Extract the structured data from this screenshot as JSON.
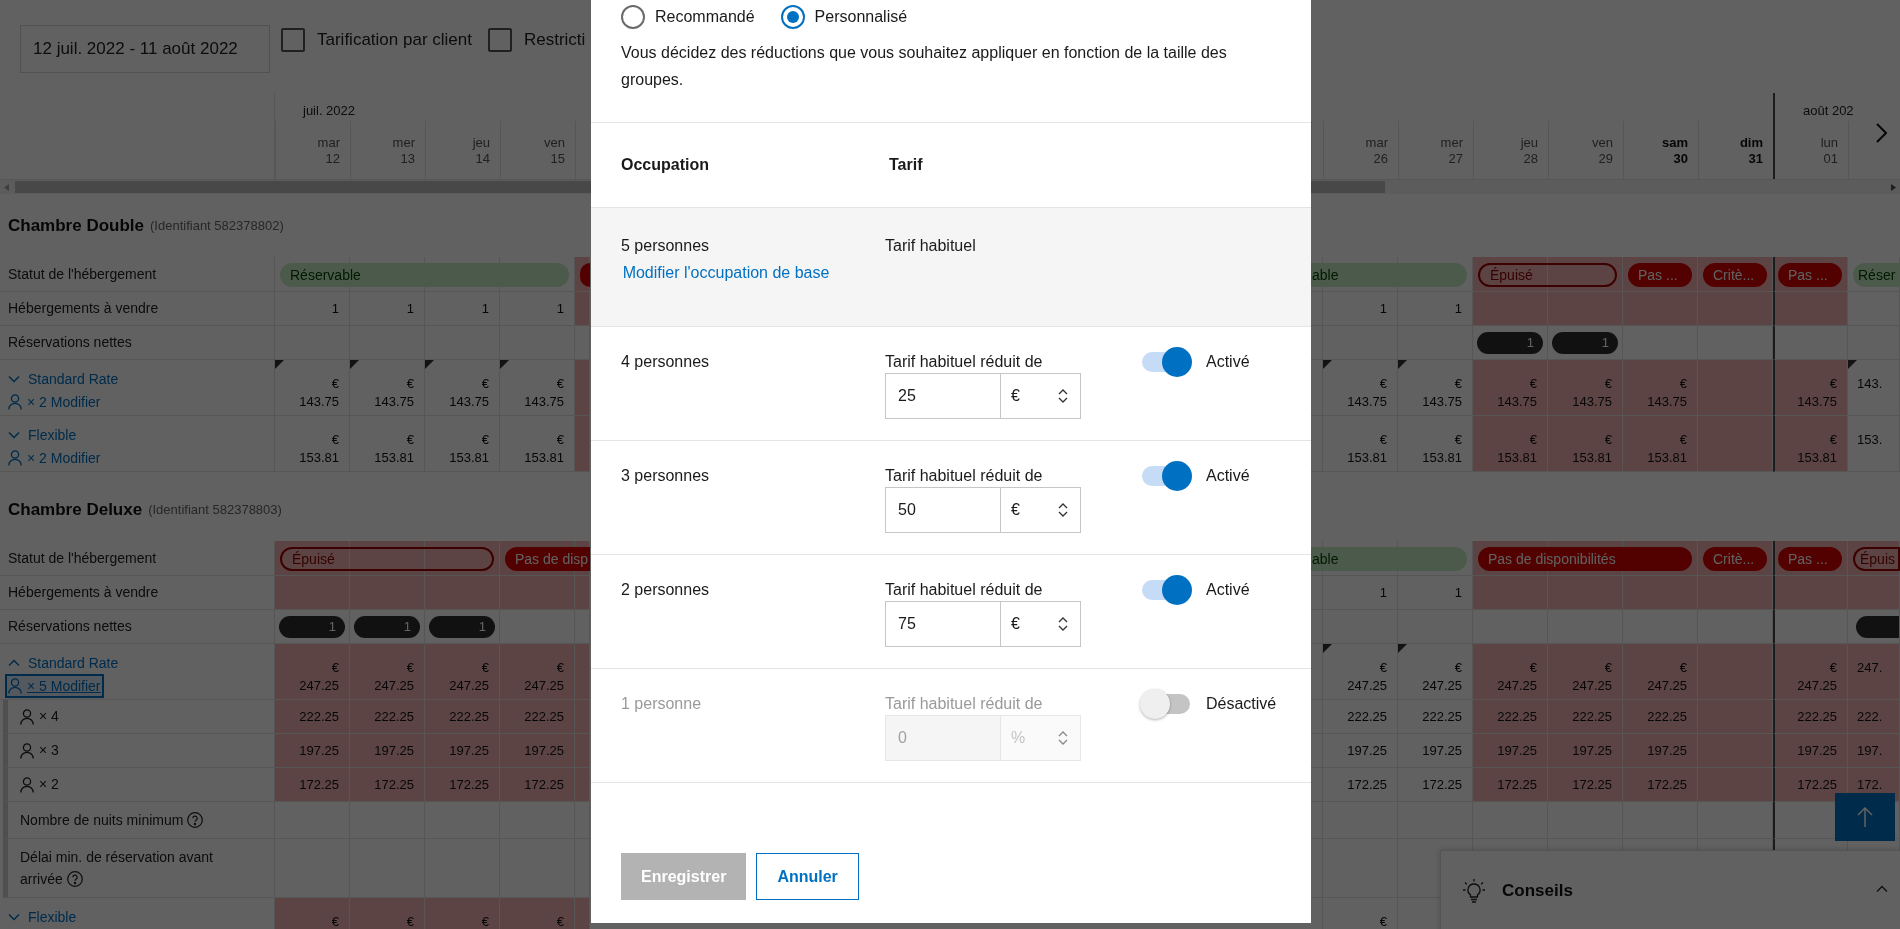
{
  "toolbar": {
    "date_range": "12 juil. 2022 - 11 août 2022",
    "filters": [
      {
        "label": "Tarification par client",
        "checked": false
      },
      {
        "label": "Restricti",
        "checked": false
      }
    ]
  },
  "calendar": {
    "left_days": [
      {
        "kind": "day",
        "month": "juil. 2022",
        "weekday": "mar",
        "day": "12",
        "weekend": false,
        "month_start": false
      },
      {
        "kind": "day",
        "weekday": "mer",
        "day": "13",
        "weekend": false,
        "month_start": false
      },
      {
        "kind": "day",
        "weekday": "jeu",
        "day": "14",
        "weekend": false,
        "month_start": false
      },
      {
        "kind": "day",
        "weekday": "ven",
        "day": "15",
        "weekend": false,
        "month_start": false
      },
      {
        "kind": "clip_end"
      }
    ],
    "right_days": [
      {
        "kind": "clip_start"
      },
      {
        "kind": "day",
        "weekday": "mar",
        "day": "26",
        "weekend": false,
        "month_start": false
      },
      {
        "kind": "day",
        "weekday": "mer",
        "day": "27",
        "weekend": false,
        "month_start": false
      },
      {
        "kind": "day",
        "weekday": "jeu",
        "day": "28",
        "weekend": false,
        "month_start": false
      },
      {
        "kind": "day",
        "weekday": "ven",
        "day": "29",
        "weekend": false,
        "month_start": false
      },
      {
        "kind": "day",
        "weekday": "sam",
        "day": "30",
        "weekend": true,
        "month_start": false
      },
      {
        "kind": "day",
        "weekday": "dim",
        "day": "31",
        "weekend": true,
        "month_start": false
      },
      {
        "kind": "day",
        "month": "août 202",
        "weekday": "lun",
        "day": "01",
        "weekend": false,
        "month_start": true
      },
      {
        "kind": "edge"
      }
    ],
    "rooms": [
      {
        "name": "Chambre Double",
        "id_text": "(Identifiant 582378802)",
        "rows": [
          {
            "kind": "status",
            "label": "Statut de l'hébergement",
            "left": [
              {
                "kind": "available",
                "label": "Réservable",
                "cells": [
                  {
                    "red": false
                  },
                  {
                    "red": false
                  },
                  {
                    "red": false
                  },
                  {
                    "red": false
                  }
                ]
              },
              {
                "kind": "closed",
                "cells": [
                  {
                    "red": true
                  }
                ]
              }
            ],
            "right": [
              {
                "kind": "available",
                "label": "able",
                "cells": [
                  {
                    "red": false
                  },
                  {
                    "red": false
                  },
                  {
                    "red": false
                  }
                ]
              },
              {
                "kind": "soldout",
                "label": "Épuisé",
                "cells": [
                  {
                    "red": true
                  },
                  {
                    "red": true
                  }
                ]
              },
              {
                "kind": "closed",
                "label": "Pas ...",
                "cells": [
                  {
                    "red": true
                  }
                ]
              },
              {
                "kind": "closed",
                "label": "Critè...",
                "cells": [
                  {
                    "red": true
                  }
                ]
              },
              {
                "kind": "closed",
                "label": "Pas ...",
                "cells": [
                  {
                    "red": true
                  }
                ]
              },
              {
                "kind": "available",
                "label": "Réser",
                "cells": [
                  {
                    "red": false
                  }
                ]
              }
            ]
          },
          {
            "kind": "count",
            "label": "Hébergements à vendre",
            "left": [
              {
                "kind": "plain",
                "text": "1",
                "red": false
              },
              {
                "kind": "plain",
                "text": "1",
                "red": false
              },
              {
                "kind": "plain",
                "text": "1",
                "red": false
              },
              {
                "kind": "plain",
                "text": "1",
                "red": false
              },
              {
                "kind": "plain",
                "red": true
              }
            ],
            "right": [
              {
                "kind": "plain",
                "red": false
              },
              {
                "kind": "plain",
                "text": "1",
                "red": false
              },
              {
                "kind": "plain",
                "text": "1",
                "red": false
              },
              {
                "kind": "plain",
                "red": true
              },
              {
                "kind": "plain",
                "red": true
              },
              {
                "kind": "plain",
                "red": true
              },
              {
                "kind": "plain",
                "red": true
              },
              {
                "kind": "plain",
                "red": true
              },
              {
                "kind": "plain",
                "red": false
              }
            ]
          },
          {
            "kind": "count",
            "label": "Réservations nettes",
            "left": [
              {
                "kind": "plain",
                "red": false
              },
              {
                "kind": "plain",
                "red": false
              },
              {
                "kind": "plain",
                "red": false
              },
              {
                "kind": "plain",
                "red": false
              },
              {
                "kind": "plain",
                "red": false
              }
            ],
            "right": [
              {
                "kind": "plain",
                "red": false
              },
              {
                "kind": "plain",
                "red": false
              },
              {
                "kind": "plain",
                "red": false
              },
              {
                "kind": "badge",
                "text": "1",
                "red": false
              },
              {
                "kind": "badge",
                "text": "1",
                "red": false
              },
              {
                "kind": "plain",
                "red": false
              },
              {
                "kind": "plain",
                "red": false
              },
              {
                "kind": "plain",
                "red": false
              },
              {
                "kind": "plain",
                "red": false
              }
            ]
          },
          {
            "kind": "rate",
            "name": "Standard Rate",
            "expanded": false,
            "modifier": "× 2 Modifier",
            "focused": false,
            "left": [
              {
                "currency": "€",
                "value": "143.75",
                "red": false,
                "flag": true
              },
              {
                "currency": "€",
                "value": "143.75",
                "red": false,
                "flag": true
              },
              {
                "currency": "€",
                "value": "143.75",
                "red": false,
                "flag": true
              },
              {
                "currency": "€",
                "value": "143.75",
                "red": false,
                "flag": true
              },
              {
                "red": true,
                "flag": false
              }
            ],
            "right": [
              {
                "red": false,
                "flag": false
              },
              {
                "currency": "€",
                "value": "143.75",
                "red": false,
                "flag": true
              },
              {
                "currency": "€",
                "value": "143.75",
                "red": false,
                "flag": true
              },
              {
                "currency": "€",
                "value": "143.75",
                "red": true,
                "flag": false
              },
              {
                "currency": "€",
                "value": "143.75",
                "red": true,
                "flag": false
              },
              {
                "currency": "€",
                "value": "143.75",
                "red": true,
                "flag": false
              },
              {
                "red": true,
                "flag": false
              },
              {
                "currency": "€",
                "value": "143.75",
                "red": true,
                "flag": false
              },
              {
                "value": "143.",
                "red": false,
                "flag": true
              }
            ]
          },
          {
            "kind": "rate",
            "name": "Flexible",
            "expanded": false,
            "modifier": "× 2 Modifier",
            "focused": false,
            "left": [
              {
                "currency": "€",
                "value": "153.81",
                "red": false,
                "flag": false
              },
              {
                "currency": "€",
                "value": "153.81",
                "red": false,
                "flag": false
              },
              {
                "currency": "€",
                "value": "153.81",
                "red": false,
                "flag": false
              },
              {
                "currency": "€",
                "value": "153.81",
                "red": false,
                "flag": false
              },
              {
                "red": true,
                "flag": false
              }
            ],
            "right": [
              {
                "red": false,
                "flag": false
              },
              {
                "currency": "€",
                "value": "153.81",
                "red": false,
                "flag": false
              },
              {
                "currency": "€",
                "value": "153.81",
                "red": false,
                "flag": false
              },
              {
                "currency": "€",
                "value": "153.81",
                "red": true,
                "flag": false
              },
              {
                "currency": "€",
                "value": "153.81",
                "red": true,
                "flag": false
              },
              {
                "currency": "€",
                "value": "153.81",
                "red": true,
                "flag": false
              },
              {
                "red": true,
                "flag": false
              },
              {
                "currency": "€",
                "value": "153.81",
                "red": true,
                "flag": false
              },
              {
                "value": "153.",
                "red": false,
                "flag": false
              }
            ]
          }
        ]
      },
      {
        "name": "Chambre Deluxe",
        "id_text": "(Identifiant 582378803)",
        "rows": [
          {
            "kind": "status",
            "label": "Statut de l'hébergement",
            "left": [
              {
                "kind": "soldout",
                "label": "Épuisé",
                "cells": [
                  {
                    "red": true
                  },
                  {
                    "red": true
                  },
                  {
                    "red": true
                  }
                ]
              },
              {
                "kind": "closed",
                "label": "Pas de disp",
                "cells": [
                  {
                    "red": true
                  },
                  {
                    "red": true
                  }
                ]
              }
            ],
            "right": [
              {
                "kind": "available",
                "label": "able",
                "cells": [
                  {
                    "red": false
                  },
                  {
                    "red": false
                  },
                  {
                    "red": false
                  }
                ]
              },
              {
                "kind": "closed",
                "label": "Pas de disponibilités",
                "cells": [
                  {
                    "red": true
                  },
                  {
                    "red": true
                  },
                  {
                    "red": true
                  }
                ]
              },
              {
                "kind": "closed",
                "label": "Critè...",
                "cells": [
                  {
                    "red": true
                  }
                ]
              },
              {
                "kind": "closed",
                "label": "Pas ...",
                "cells": [
                  {
                    "red": true
                  }
                ]
              },
              {
                "kind": "soldout",
                "label": "Épuis",
                "cells": [
                  {
                    "red": true
                  }
                ]
              }
            ]
          },
          {
            "kind": "count",
            "label": "Hébergements à vendre",
            "left": [
              {
                "kind": "plain",
                "red": true
              },
              {
                "kind": "plain",
                "red": true
              },
              {
                "kind": "plain",
                "red": true
              },
              {
                "kind": "plain",
                "red": true
              },
              {
                "kind": "plain",
                "red": true
              }
            ],
            "right": [
              {
                "kind": "plain",
                "red": false
              },
              {
                "kind": "plain",
                "text": "1",
                "red": false
              },
              {
                "kind": "plain",
                "text": "1",
                "red": false
              },
              {
                "kind": "plain",
                "red": true
              },
              {
                "kind": "plain",
                "red": true
              },
              {
                "kind": "plain",
                "red": true
              },
              {
                "kind": "plain",
                "red": true
              },
              {
                "kind": "plain",
                "red": true
              },
              {
                "kind": "plain",
                "red": true
              }
            ]
          },
          {
            "kind": "count",
            "label": "Réservations nettes",
            "left": [
              {
                "kind": "badge",
                "text": "1",
                "red": false
              },
              {
                "kind": "badge",
                "text": "1",
                "red": false
              },
              {
                "kind": "badge",
                "text": "1",
                "red": false
              },
              {
                "kind": "plain",
                "red": false
              },
              {
                "kind": "plain",
                "red": false
              }
            ],
            "right": [
              {
                "kind": "plain",
                "red": false
              },
              {
                "kind": "plain",
                "red": false
              },
              {
                "kind": "plain",
                "red": false
              },
              {
                "kind": "plain",
                "red": false
              },
              {
                "kind": "plain",
                "red": false
              },
              {
                "kind": "plain",
                "red": false
              },
              {
                "kind": "plain",
                "red": false
              },
              {
                "kind": "plain",
                "red": false
              },
              {
                "kind": "badge",
                "red": false
              }
            ]
          },
          {
            "kind": "rate",
            "name": "Standard Rate",
            "expanded": true,
            "modifier": "× 5 Modifier",
            "focused": true,
            "left": [
              {
                "currency": "€",
                "value": "247.25",
                "red": true,
                "flag": false
              },
              {
                "currency": "€",
                "value": "247.25",
                "red": true,
                "flag": false
              },
              {
                "currency": "€",
                "value": "247.25",
                "red": true,
                "flag": false
              },
              {
                "currency": "€",
                "value": "247.25",
                "red": true,
                "flag": false
              },
              {
                "red": true,
                "flag": false
              }
            ],
            "right": [
              {
                "red": false,
                "flag": false
              },
              {
                "currency": "€",
                "value": "247.25",
                "red": false,
                "flag": true
              },
              {
                "currency": "€",
                "value": "247.25",
                "red": false,
                "flag": true
              },
              {
                "currency": "€",
                "value": "247.25",
                "red": true,
                "flag": false
              },
              {
                "currency": "€",
                "value": "247.25",
                "red": true,
                "flag": false
              },
              {
                "currency": "€",
                "value": "247.25",
                "red": true,
                "flag": false
              },
              {
                "red": true,
                "flag": false
              },
              {
                "currency": "€",
                "value": "247.25",
                "red": true,
                "flag": false
              },
              {
                "value": "247.",
                "red": true,
                "flag": false
              }
            ],
            "children": [
              {
                "kind": "occupancy",
                "label": "× 4",
                "left": [
                  {
                    "value": "222.25",
                    "red": true
                  },
                  {
                    "value": "222.25",
                    "red": true
                  },
                  {
                    "value": "222.25",
                    "red": true
                  },
                  {
                    "value": "222.25",
                    "red": true
                  },
                  {
                    "red": true
                  }
                ],
                "right": [
                  {
                    "red": false
                  },
                  {
                    "value": "222.25",
                    "red": false
                  },
                  {
                    "value": "222.25",
                    "red": false
                  },
                  {
                    "value": "222.25",
                    "red": true
                  },
                  {
                    "value": "222.25",
                    "red": true
                  },
                  {
                    "value": "222.25",
                    "red": true
                  },
                  {
                    "red": true
                  },
                  {
                    "value": "222.25",
                    "red": true
                  },
                  {
                    "value": "222.",
                    "red": true
                  }
                ]
              },
              {
                "kind": "occupancy",
                "label": "× 3",
                "left": [
                  {
                    "value": "197.25",
                    "red": true
                  },
                  {
                    "value": "197.25",
                    "red": true
                  },
                  {
                    "value": "197.25",
                    "red": true
                  },
                  {
                    "value": "197.25",
                    "red": true
                  },
                  {
                    "red": true
                  }
                ],
                "right": [
                  {
                    "red": false
                  },
                  {
                    "value": "197.25",
                    "red": false
                  },
                  {
                    "value": "197.25",
                    "red": false
                  },
                  {
                    "value": "197.25",
                    "red": true
                  },
                  {
                    "value": "197.25",
                    "red": true
                  },
                  {
                    "value": "197.25",
                    "red": true
                  },
                  {
                    "red": true
                  },
                  {
                    "value": "197.25",
                    "red": true
                  },
                  {
                    "value": "197.",
                    "red": true
                  }
                ]
              },
              {
                "kind": "occupancy",
                "label": "× 2",
                "left": [
                  {
                    "value": "172.25",
                    "red": true
                  },
                  {
                    "value": "172.25",
                    "red": true
                  },
                  {
                    "value": "172.25",
                    "red": true
                  },
                  {
                    "value": "172.25",
                    "red": true
                  },
                  {
                    "red": true
                  }
                ],
                "right": [
                  {
                    "red": false
                  },
                  {
                    "value": "172.25",
                    "red": false
                  },
                  {
                    "value": "172.25",
                    "red": false
                  },
                  {
                    "value": "172.25",
                    "red": true
                  },
                  {
                    "value": "172.25",
                    "red": true
                  },
                  {
                    "value": "172.25",
                    "red": true
                  },
                  {
                    "red": true
                  },
                  {
                    "value": "172.25",
                    "red": true
                  },
                  {
                    "value": "172.",
                    "red": true
                  }
                ]
              },
              {
                "kind": "info",
                "label": "Nombre de nuits minimum"
              },
              {
                "kind": "info",
                "label": "Délai min. de réservation avant arrivée"
              }
            ]
          },
          {
            "kind": "rate",
            "name": "Flexible",
            "expanded": false,
            "left": [
              {
                "currency": "€",
                "red": true,
                "flag": false
              },
              {
                "currency": "€",
                "red": true,
                "flag": false
              },
              {
                "currency": "€",
                "red": true,
                "flag": false
              },
              {
                "currency": "€",
                "red": true,
                "flag": false
              },
              {
                "red": true,
                "flag": false
              }
            ],
            "right": [
              {
                "red": false,
                "flag": false
              },
              {
                "currency": "€",
                "red": false,
                "flag": false
              },
              {
                "red": false,
                "flag": false
              }
            ]
          }
        ]
      }
    ]
  },
  "dialog": {
    "modes": [
      {
        "label": "Recommandé",
        "selected": false
      },
      {
        "label": "Personnalisé",
        "selected": true
      }
    ],
    "description": "Vous décidez des réductions que vous souhaitez appliquer en fonction de la taille des groupes.",
    "columns": [
      "Occupation",
      "Tarif"
    ],
    "rows": [
      {
        "kind": "base",
        "occupancy": "5 personnes",
        "link": "Modifier l'occupation de base",
        "rate": "Tarif habituel"
      },
      {
        "kind": "discount",
        "occupancy": "4 personnes",
        "rate": "Tarif habituel réduit de",
        "value": "25",
        "unit": "€",
        "on": true,
        "status": "Activé"
      },
      {
        "kind": "discount",
        "occupancy": "3 personnes",
        "rate": "Tarif habituel réduit de",
        "value": "50",
        "unit": "€",
        "on": true,
        "status": "Activé"
      },
      {
        "kind": "discount",
        "occupancy": "2 personnes",
        "rate": "Tarif habituel réduit de",
        "value": "75",
        "unit": "€",
        "on": true,
        "status": "Activé"
      },
      {
        "kind": "discount",
        "occupancy": "1 personne",
        "rate": "Tarif habituel réduit de",
        "value": "0",
        "unit": "%",
        "on": false,
        "status": "Désactivé"
      }
    ],
    "buttons": [
      {
        "kind": "primary",
        "label": "Enregistrer",
        "disabled": true
      },
      {
        "kind": "secondary",
        "label": "Annuler",
        "disabled": false
      }
    ]
  },
  "tips_panel": {
    "title": "Conseils",
    "expanded": false
  }
}
